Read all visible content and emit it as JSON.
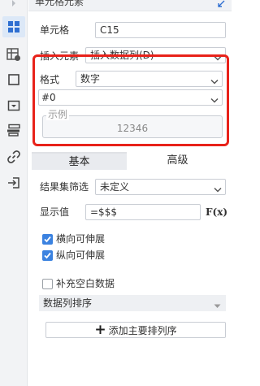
{
  "panel": {
    "title": "单元格元素",
    "cell_label": "单元格",
    "cell_value": "C15",
    "insert_label": "插入元素",
    "insert_value": "插入数据列(D)",
    "format_label": "格式",
    "format_value": "数字",
    "pattern_value": "#0",
    "example_legend": "示例",
    "example_value": "12346"
  },
  "tabs": [
    {
      "label": "基本",
      "active": true
    },
    {
      "label": "高级",
      "active": false
    }
  ],
  "advanced": {
    "filter_label": "结果集筛选",
    "filter_value": "未定义",
    "display_label": "显示值",
    "display_value": "=$$$",
    "fx_label": "F(x)",
    "vertical_expand": {
      "label": "横向可伸展",
      "checked": true
    },
    "horizontal_expand": {
      "label": "纵向可伸展",
      "checked": true
    },
    "fill_blank": {
      "label": "补充空白数据",
      "checked": false
    },
    "sort_label": "数据列排序",
    "add_sort_button": "添加主要排列序"
  },
  "colors": {
    "accent": "#3b82e0",
    "highlight_frame": "#e8221a",
    "icon": "#2f6fd1"
  },
  "sidebar_icons": [
    "arrow-icon",
    "cell-grid-icon",
    "cell-attribute-icon",
    "border-icon",
    "widget-icon",
    "stack-icon",
    "link-icon",
    "import-icon"
  ]
}
